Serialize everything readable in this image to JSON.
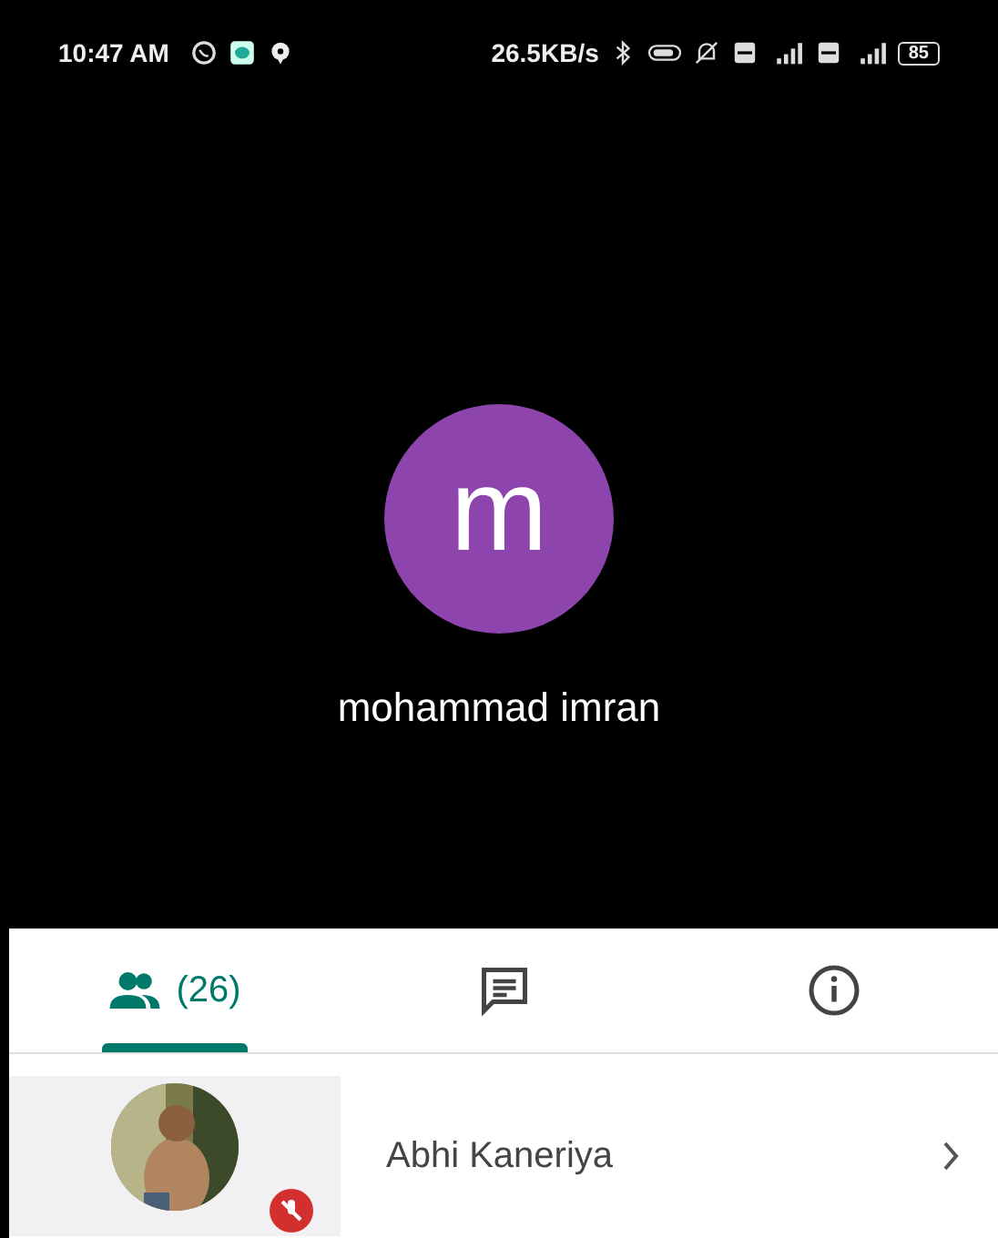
{
  "status_bar": {
    "time": "10:47 AM",
    "speed": "26.5KB/s",
    "battery": "85"
  },
  "speaker": {
    "initial": "m",
    "name": "mohammad imran",
    "color": "#8e44ad"
  },
  "tabs": [
    {
      "kind": "people",
      "label": "(26)",
      "selected": true
    },
    {
      "kind": "chat",
      "selected": false
    },
    {
      "kind": "info",
      "selected": false
    }
  ],
  "participants": [
    {
      "name": "Abhi Kaneriya",
      "muted": true
    }
  ]
}
